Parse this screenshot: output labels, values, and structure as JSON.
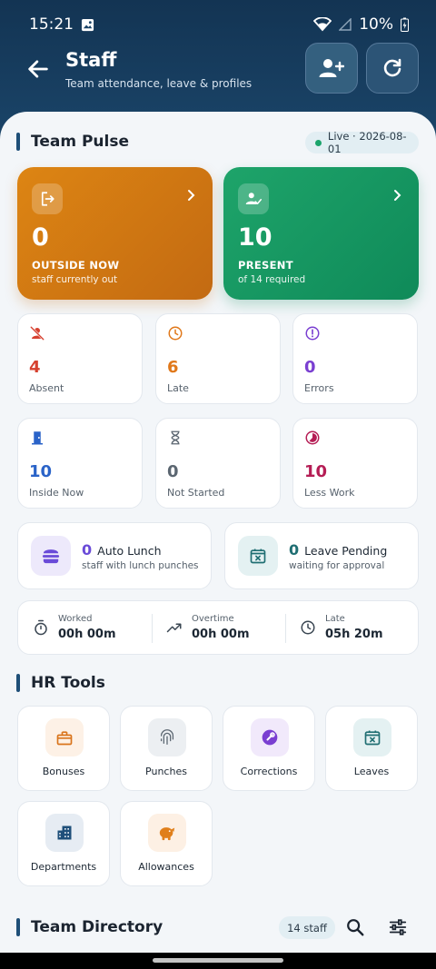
{
  "status_bar": {
    "time": "15:21",
    "battery": "10%"
  },
  "header": {
    "title": "Staff",
    "subtitle": "Team attendance, leave & profiles"
  },
  "team_pulse": {
    "title": "Team Pulse",
    "live_label": "Live · 2026-08-01",
    "outside": {
      "value": "0",
      "label": "OUTSIDE NOW",
      "sub": "staff currently out"
    },
    "present": {
      "value": "10",
      "label": "PRESENT",
      "sub": "of 14 required"
    },
    "stats": [
      {
        "value": "4",
        "label": "Absent",
        "color": "#d6402f",
        "icon": "person-off-icon"
      },
      {
        "value": "6",
        "label": "Late",
        "color": "#e0781a",
        "icon": "clock-icon"
      },
      {
        "value": "0",
        "label": "Errors",
        "color": "#7a3fd1",
        "icon": "error-icon"
      },
      {
        "value": "10",
        "label": "Inside Now",
        "color": "#2a63c8",
        "icon": "door-icon"
      },
      {
        "value": "0",
        "label": "Not Started",
        "color": "#5b6671",
        "icon": "hourglass-icon"
      },
      {
        "value": "10",
        "label": "Less Work",
        "color": "#b51d55",
        "icon": "timelapse-icon"
      }
    ],
    "auto_lunch": {
      "value": "0",
      "label": "Auto Lunch",
      "sub": "staff with lunch punches"
    },
    "leave_pending": {
      "value": "0",
      "label": "Leave Pending",
      "sub": "waiting for approval"
    },
    "totals": [
      {
        "key": "Worked",
        "value": "00h 00m",
        "icon": "stopwatch-icon"
      },
      {
        "key": "Overtime",
        "value": "00h 00m",
        "icon": "trending-up-icon"
      },
      {
        "key": "Late",
        "value": "05h 20m",
        "icon": "clock-icon"
      }
    ]
  },
  "hr_tools": {
    "title": "HR Tools",
    "items": [
      {
        "label": "Bonuses",
        "icon": "gift-icon",
        "tint": "#fdf1e6",
        "color": "#d9741b"
      },
      {
        "label": "Punches",
        "icon": "fingerprint-icon",
        "tint": "#eceff2",
        "color": "#5b6671"
      },
      {
        "label": "Corrections",
        "icon": "wrench-icon",
        "tint": "#f1e9fb",
        "color": "#7a3fd1"
      },
      {
        "label": "Leaves",
        "icon": "calendar-x-icon",
        "tint": "#e4f1f2",
        "color": "#1f6e72"
      },
      {
        "label": "Departments",
        "icon": "building-icon",
        "tint": "#e6ecf3",
        "color": "#1f4f7a"
      },
      {
        "label": "Allowances",
        "icon": "piggy-bank-icon",
        "tint": "#fdf0e4",
        "color": "#e07f1b"
      }
    ]
  },
  "directory": {
    "title": "Team Directory",
    "count_label": "14 staff"
  }
}
